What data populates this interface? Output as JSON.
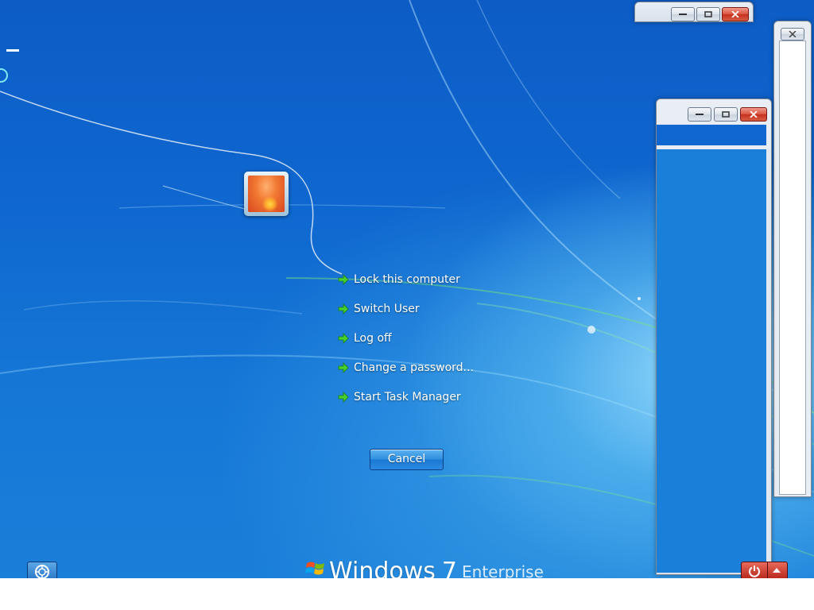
{
  "security_screen": {
    "user_tile": {
      "icon": "user-tile-flower"
    },
    "options": [
      {
        "label": "Lock this computer",
        "icon": "green-arrow-icon"
      },
      {
        "label": "Switch User",
        "icon": "green-arrow-icon"
      },
      {
        "label": "Log off",
        "icon": "green-arrow-icon"
      },
      {
        "label": "Change a password...",
        "icon": "green-arrow-icon"
      },
      {
        "label": "Start Task Manager",
        "icon": "green-arrow-icon"
      }
    ],
    "cancel_label": "Cancel"
  },
  "branding": {
    "word": "Windows",
    "version": "7",
    "edition": "Enterprise"
  },
  "bottom_buttons": {
    "ease_of_access": {
      "icon": "ease-of-access-icon"
    },
    "shutdown": {
      "icon": "power-icon"
    },
    "shutdown_options": {
      "icon": "arrow-up-icon"
    }
  },
  "colors": {
    "background": "#1167cf",
    "option_arrow": "#3fcf2a",
    "cancel_button": "#2f8fe0",
    "shutdown_button": "#c5321f"
  }
}
